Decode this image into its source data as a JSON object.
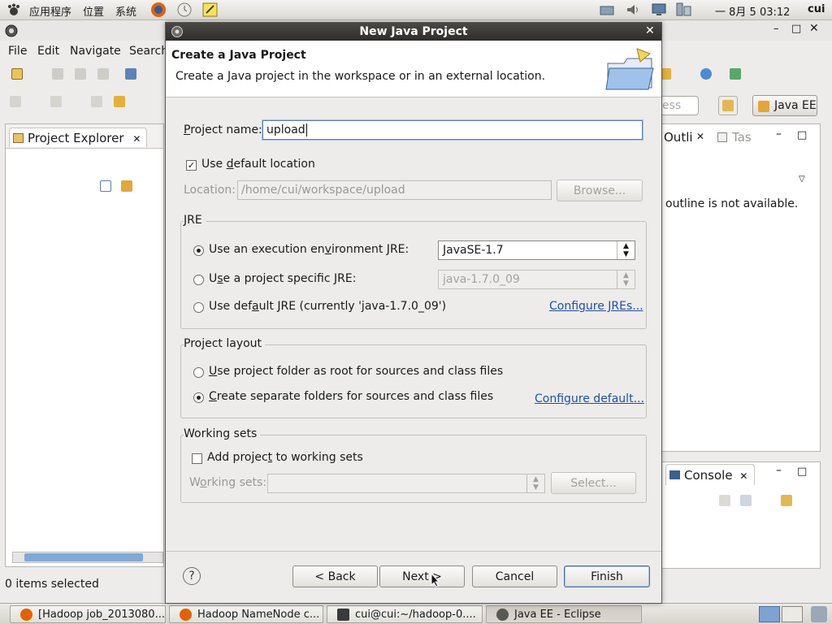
{
  "top_panel": {
    "menus": [
      "应用程序",
      "位置",
      "系统"
    ],
    "clock": "一 8月  5 03:12",
    "user": "cui"
  },
  "eclipse": {
    "menu": [
      "File",
      "Edit",
      "Navigate",
      "Search"
    ],
    "perspective_search": "ess",
    "perspective_label": "Java EE",
    "project_explorer_tab": "Project Explorer",
    "outline_tab": "Outli",
    "tasks_tab": "Tas",
    "outline_message": "outline is not available.",
    "console_tab": "Console",
    "status": "0 items selected"
  },
  "dialog": {
    "title": "New Java Project",
    "heading": "Create a Java Project",
    "description": "Create a Java project in the workspace or in an external location.",
    "project_name_label": "Project name:",
    "project_name_value": "upload",
    "use_default_location_label": "Use default location",
    "use_default_location_checked": true,
    "location_label": "Location:",
    "location_value": "/home/cui/workspace/upload",
    "browse_label": "Browse...",
    "jre": {
      "title": "JRE",
      "options": [
        {
          "label": "Use an execution environment JRE:",
          "selected": true
        },
        {
          "label": "Use a project specific JRE:",
          "selected": false
        },
        {
          "label": "Use default JRE (currently 'java-1.7.0_09')",
          "selected": false
        }
      ],
      "execution_env_value": "JavaSE-1.7",
      "project_jre_value": "java-1.7.0_09",
      "configure_link": "Configure JREs..."
    },
    "layout": {
      "title": "Project layout",
      "options": [
        {
          "label": "Use project folder as root for sources and class files",
          "selected": false
        },
        {
          "label": "Create separate folders for sources and class files",
          "selected": true
        }
      ],
      "configure_link": "Configure default..."
    },
    "working_sets": {
      "title": "Working sets",
      "add_label": "Add project to working sets",
      "add_checked": false,
      "sets_label": "Working sets:",
      "sets_value": "",
      "select_label": "Select..."
    },
    "buttons": {
      "back": "< Back",
      "next": "Next >",
      "cancel": "Cancel",
      "finish": "Finish"
    }
  },
  "taskbar": {
    "tasks": [
      "[Hadoop job_2013080...",
      "Hadoop NameNode c...",
      "cui@cui:~/hadoop-0....",
      "Java EE - Eclipse"
    ]
  },
  "colors": {
    "dialog_titlebar": "#2e2d2a",
    "link": "#1f4fb0",
    "scroll_thumb": "#7fa9d6"
  }
}
